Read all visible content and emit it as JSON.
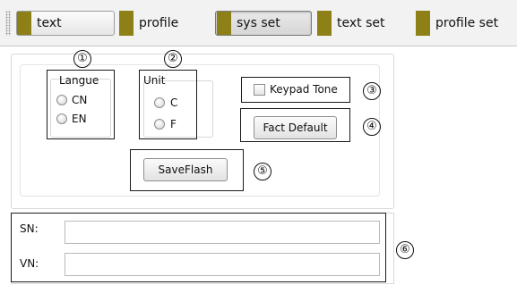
{
  "toolbar": {
    "items": [
      {
        "label": "text"
      },
      {
        "label": "profile"
      },
      {
        "label": "sys set"
      },
      {
        "label": "text set"
      },
      {
        "label": "profile set"
      }
    ]
  },
  "settings": {
    "language": {
      "title": "Langue",
      "options": [
        "CN",
        "EN"
      ]
    },
    "unit": {
      "title": "Unit",
      "options": [
        "C",
        "F"
      ]
    },
    "keypad_tone_label": "Keypad Tone",
    "fact_default_label": "Fact Default",
    "saveflash_label": "SaveFlash"
  },
  "callouts": [
    "①",
    "②",
    "③",
    "④",
    "⑤",
    "⑥"
  ],
  "device_info": {
    "sn_label": "SN:",
    "sn_value": "",
    "vn_label": "VN:",
    "vn_value": ""
  },
  "colors": {
    "toolbar_icon": "#8c8016"
  }
}
